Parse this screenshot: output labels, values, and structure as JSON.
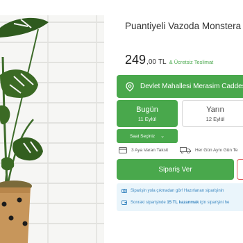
{
  "product": {
    "title": "Puantiyeli Vazoda Monstera",
    "price_main": "249",
    "price_decimal": ",00",
    "currency": "TL",
    "shipping_note": "& Ücretsiz Teslimat"
  },
  "delivery": {
    "address": "Devlet Mahallesi Merasim Caddesi No:",
    "days": [
      {
        "label": "Bugün",
        "date": "11 Eylül",
        "selected": true
      },
      {
        "label": "Yarın",
        "date": "12 Eylül",
        "selected": false
      }
    ],
    "time_select": "Saat Seçiniz"
  },
  "features": [
    {
      "icon": "card-icon",
      "text": "3 Aya Varan Taksit"
    },
    {
      "icon": "truck-icon",
      "text": "Her Gün Aynı Gün Te"
    }
  ],
  "actions": {
    "order_label": "Sipariş Ver"
  },
  "info": {
    "line1": "Siparişin yola çıkmadan gör! Hazırlanan siparişinin",
    "line2_pre": "Sonraki siparişinde",
    "line2_bold": "15 TL kazanmak",
    "line2_post": "için siparişini he"
  },
  "colors": {
    "accent": "#49a84c",
    "info_bg": "#eaf5fb",
    "info_text": "#3b87c0"
  }
}
